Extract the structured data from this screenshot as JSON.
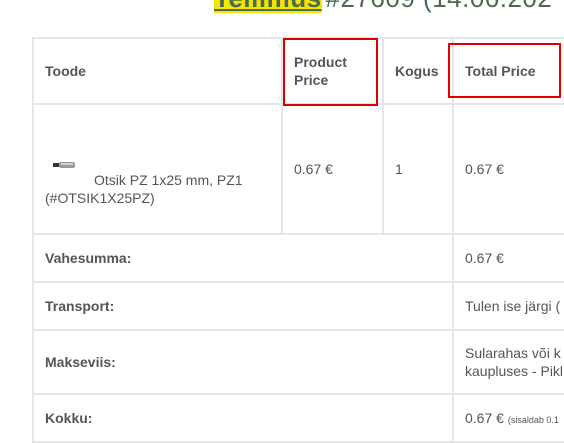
{
  "page_header": {
    "title_highlight": "Tellimus",
    "title_rest": "#27609 (14.06.202"
  },
  "table": {
    "headers": {
      "product": "Toode",
      "price": "Product Price",
      "qty": "Kogus",
      "total": "Total Price"
    },
    "item": {
      "name": "Otsik PZ 1x25 mm, PZ1",
      "sku": "(#OTSIK1X25PZ)",
      "price": "0.67 €",
      "qty": "1",
      "total": "0.67 €"
    },
    "summary": {
      "subtotal_label": "Vahesumma:",
      "subtotal_value": "0.67 €",
      "shipping_label": "Transport:",
      "shipping_value": "Tulen ise järgi (",
      "payment_label": "Makseviis:",
      "payment_value_line1": "Sularahas või k",
      "payment_value_line2": "kaupluses - Pikl",
      "total_label": "Kokku:",
      "total_value": "0.67 €",
      "total_note": "(sisaldab 0.1"
    }
  },
  "colors": {
    "label_green": "#4f6a4f",
    "highlight_red": "#e00000",
    "highlight_yellow": "#f5e600",
    "border": "#e6e6e6"
  }
}
